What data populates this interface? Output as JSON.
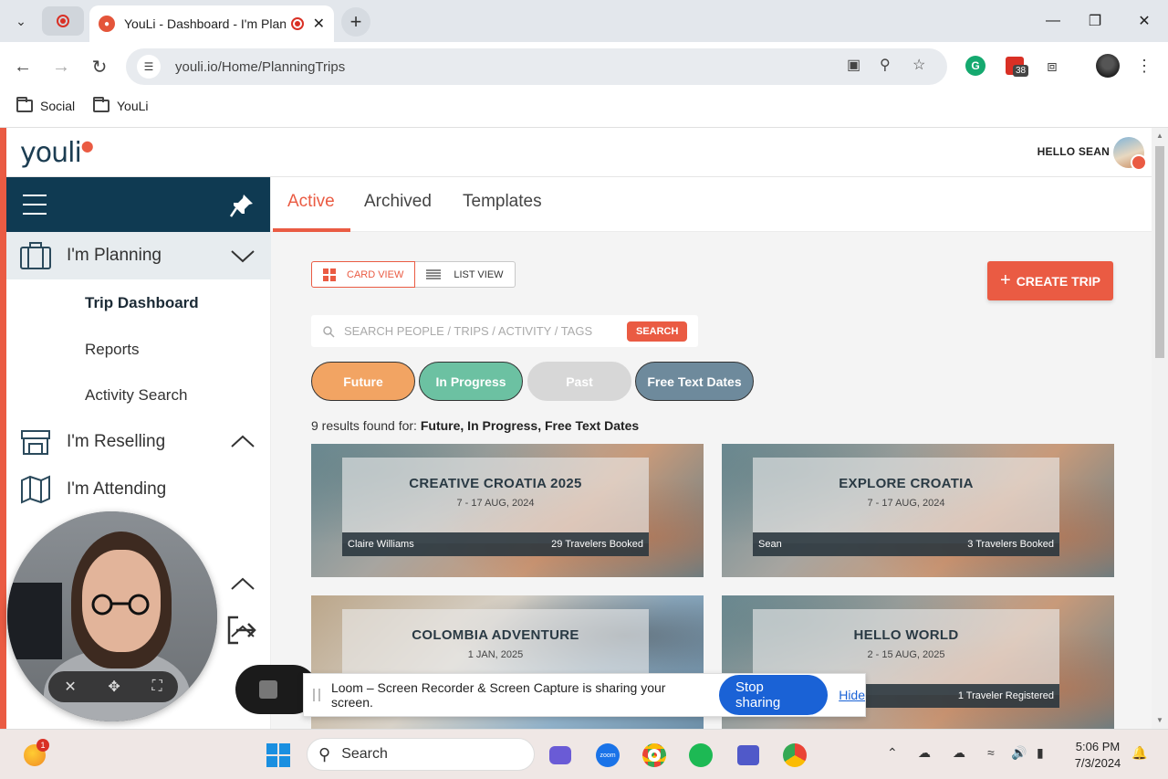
{
  "browser": {
    "tab_title": "YouLi - Dashboard - I'm Planning",
    "url": "youli.io/Home/PlanningTrips",
    "bookmarks": [
      "Social",
      "YouLi"
    ],
    "extension_badge": "38"
  },
  "app": {
    "logo": "youli",
    "greeting": "HELLO SEAN"
  },
  "sidebar": {
    "planning": "I'm Planning",
    "sub_items": [
      "Trip Dashboard",
      "Reports",
      "Activity Search"
    ],
    "reselling": "I'm Reselling",
    "attending": "I'm Attending"
  },
  "tabs": [
    "Active",
    "Archived",
    "Templates"
  ],
  "view": {
    "card_view": "CARD VIEW",
    "list_view": "LIST VIEW"
  },
  "create_trip": "CREATE TRIP",
  "search": {
    "placeholder": "SEARCH PEOPLE / TRIPS / ACTIVITY / TAGS",
    "button": "SEARCH"
  },
  "filters": [
    "Future",
    "In Progress",
    "Past",
    "Free Text Dates"
  ],
  "results": {
    "prefix": "9 results found for:",
    "terms": "Future, In Progress, Free Text Dates"
  },
  "cards": [
    {
      "title": "CREATIVE CROATIA 2025",
      "date": "7 - 17 AUG, 2024",
      "owner": "Claire Williams",
      "travelers": "29 Travelers Booked"
    },
    {
      "title": "EXPLORE CROATIA",
      "date": "7 - 17 AUG, 2024",
      "owner": "Sean",
      "travelers": "3 Travelers Booked"
    },
    {
      "title": "COLOMBIA ADVENTURE",
      "date": "1 JAN, 2025",
      "owner": "",
      "travelers": ""
    },
    {
      "title": "HELLO WORLD",
      "date": "2 - 15 AUG, 2025",
      "owner": "",
      "travelers": "1 Traveler Registered"
    }
  ],
  "share_bar": {
    "message": "Loom – Screen Recorder & Screen Capture is sharing your screen.",
    "stop": "Stop sharing",
    "hide": "Hide"
  },
  "taskbar": {
    "search": "Search",
    "time": "5:06 PM",
    "date": "7/3/2024",
    "notification_badge": "1",
    "zoom_label": "zoom"
  }
}
